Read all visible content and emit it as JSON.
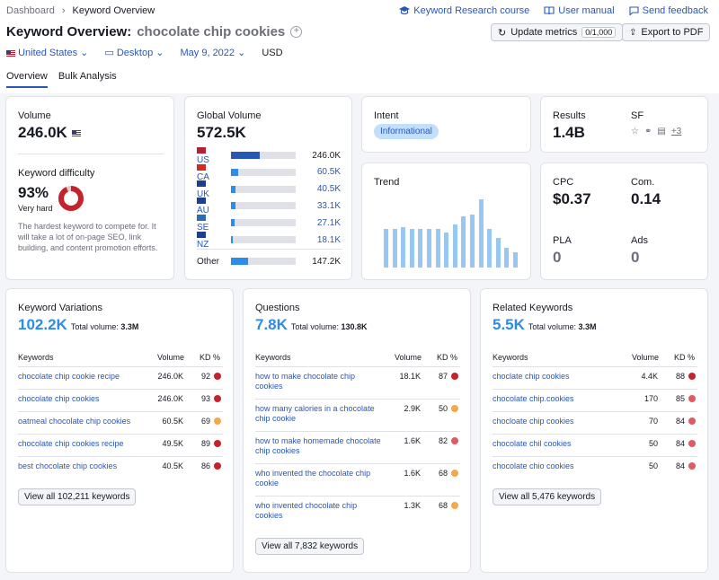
{
  "breadcrumb": [
    "Dashboard",
    "Keyword Overview"
  ],
  "top_links": {
    "course": "Keyword Research course",
    "manual": "User manual",
    "feedback": "Send feedback"
  },
  "title": {
    "prefix": "Keyword Overview:",
    "keyword": "chocolate chip cookies"
  },
  "buttons": {
    "update": "Update metrics",
    "update_count": "0/1,000",
    "export": "Export to PDF"
  },
  "filters": {
    "country": "United States",
    "device": "Desktop",
    "date": "May 9, 2022",
    "currency": "USD"
  },
  "tabs": [
    "Overview",
    "Bulk Analysis"
  ],
  "volume": {
    "label": "Volume",
    "value": "246.0K"
  },
  "kd": {
    "label": "Keyword difficulty",
    "value": "93%",
    "level": "Very hard",
    "percent": 93,
    "description": "The hardest keyword to compete for. It will take a lot of on-page SEO, link building, and content promotion efforts."
  },
  "global_volume": {
    "label": "Global Volume",
    "value": "572.5K",
    "rows": [
      {
        "code": "US",
        "value": "246.0K",
        "share": 0.43
      },
      {
        "code": "CA",
        "value": "60.5K",
        "share": 0.1
      },
      {
        "code": "UK",
        "value": "40.5K",
        "share": 0.07
      },
      {
        "code": "AU",
        "value": "33.1K",
        "share": 0.06
      },
      {
        "code": "SE",
        "value": "27.1K",
        "share": 0.05
      },
      {
        "code": "NZ",
        "value": "18.1K",
        "share": 0.03
      }
    ],
    "other": {
      "label": "Other",
      "value": "147.2K",
      "share": 0.26
    }
  },
  "intent": {
    "label": "Intent",
    "value": "Informational"
  },
  "results": {
    "label": "Results",
    "value": "1.4B"
  },
  "sf": {
    "label": "SF",
    "more": "+3"
  },
  "trend": {
    "label": "Trend",
    "values": [
      0.55,
      0.55,
      0.58,
      0.55,
      0.55,
      0.55,
      0.55,
      0.5,
      0.62,
      0.73,
      0.76,
      0.98,
      0.55,
      0.42,
      0.28,
      0.22
    ]
  },
  "cpc": {
    "label": "CPC",
    "value": "$0.37"
  },
  "com": {
    "label": "Com.",
    "value": "0.14"
  },
  "pla": {
    "label": "PLA",
    "value": "0"
  },
  "ads": {
    "label": "Ads",
    "value": "0"
  },
  "columns": {
    "keywords": "Keywords",
    "volume": "Volume",
    "kd": "KD %"
  },
  "variations": {
    "title": "Keyword Variations",
    "count": "102.2K",
    "total_label": "Total volume:",
    "total": "3.3M",
    "rows": [
      {
        "kw": "chocolate chip cookie recipe",
        "vol": "246.0K",
        "kd": "92",
        "color": "#c4232b"
      },
      {
        "kw": "chocolate chip cookies",
        "vol": "246.0K",
        "kd": "93",
        "color": "#c4232b"
      },
      {
        "kw": "oatmeal chocolate chip cookies",
        "vol": "60.5K",
        "kd": "69",
        "color": "#f3a94a"
      },
      {
        "kw": "chocolate chip cookies recipe",
        "vol": "49.5K",
        "kd": "89",
        "color": "#c4232b"
      },
      {
        "kw": "best chocolate chip cookies",
        "vol": "40.5K",
        "kd": "86",
        "color": "#c4232b"
      }
    ],
    "button": "View all 102,211 keywords"
  },
  "questions": {
    "title": "Questions",
    "count": "7.8K",
    "total_label": "Total volume:",
    "total": "130.8K",
    "rows": [
      {
        "kw": "how to make chocolate chip cookies",
        "vol": "18.1K",
        "kd": "87",
        "color": "#c4232b"
      },
      {
        "kw": "how many calories in a chocolate chip cookie",
        "vol": "2.9K",
        "kd": "50",
        "color": "#f3a94a"
      },
      {
        "kw": "how to make homemade chocolate chip cookies",
        "vol": "1.6K",
        "kd": "82",
        "color": "#e05a61"
      },
      {
        "kw": "who invented the chocolate chip cookie",
        "vol": "1.6K",
        "kd": "68",
        "color": "#f3a94a"
      },
      {
        "kw": "who invented chocolate chip cookies",
        "vol": "1.3K",
        "kd": "68",
        "color": "#f3a94a"
      }
    ],
    "button": "View all 7,832 keywords"
  },
  "related": {
    "title": "Related Keywords",
    "count": "5.5K",
    "total_label": "Total volume:",
    "total": "3.3M",
    "rows": [
      {
        "kw": "choclate chip cookies",
        "vol": "4.4K",
        "kd": "88",
        "color": "#c4232b"
      },
      {
        "kw": "chocolate chip.cookies",
        "vol": "170",
        "kd": "85",
        "color": "#e05a61"
      },
      {
        "kw": "chocloate chip cookies",
        "vol": "70",
        "kd": "84",
        "color": "#e05a61"
      },
      {
        "kw": "chocolate chil cookies",
        "vol": "50",
        "kd": "84",
        "color": "#e05a61"
      },
      {
        "kw": "chocolate chio cookies",
        "vol": "50",
        "kd": "84",
        "color": "#e05a61"
      }
    ],
    "button": "View all 5,476 keywords"
  }
}
